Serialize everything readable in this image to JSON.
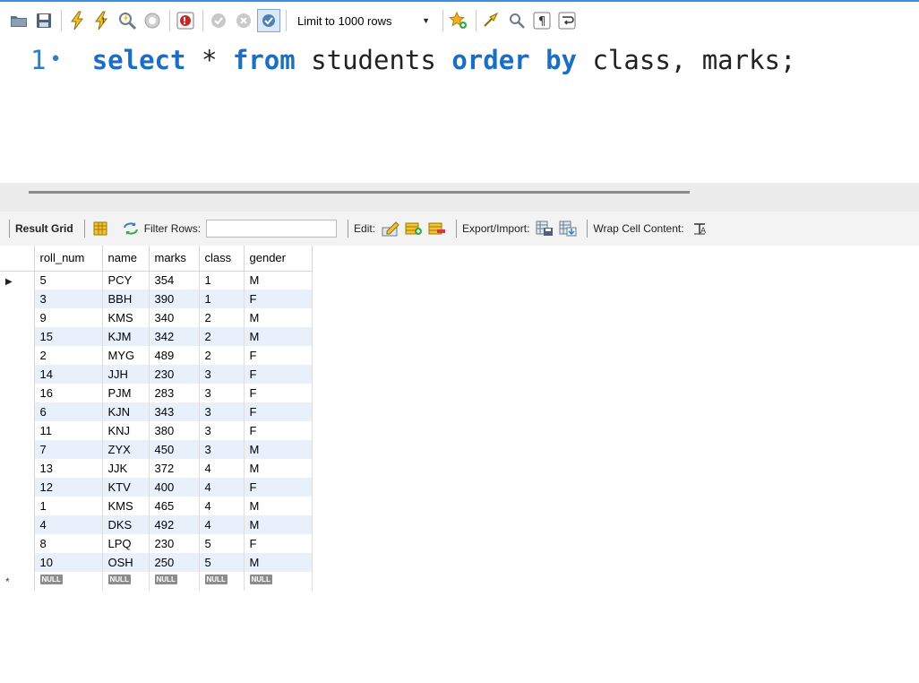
{
  "toolbar": {
    "limit_label": "Limit to 1000 rows",
    "icons": [
      "folder-icon",
      "save-icon",
      "lightning-icon",
      "lightning-cursor-icon",
      "magnifier-explain-icon",
      "stop-icon",
      "toggle-continue-icon",
      "commit-icon",
      "rollback-icon",
      "autocommit-icon",
      "bookmark-star-icon",
      "beautify-broom-icon",
      "find-icon",
      "invisible-chars-icon",
      "wrap-icon"
    ]
  },
  "editor": {
    "line_number": "1",
    "tokens": {
      "select": "select",
      "star": " * ",
      "from": "from",
      "table": " students ",
      "order_by": "order by",
      "columns": " class, marks;"
    }
  },
  "result_toolbar": {
    "result_grid": "Result Grid",
    "filter_rows": "Filter Rows:",
    "filter_value": "",
    "edit": "Edit:",
    "export_import": "Export/Import:",
    "wrap_cell": "Wrap Cell Content:"
  },
  "grid": {
    "columns": [
      "roll_num",
      "name",
      "marks",
      "class",
      "gender"
    ],
    "rows": [
      [
        "5",
        "PCY",
        "354",
        "1",
        "M"
      ],
      [
        "3",
        "BBH",
        "390",
        "1",
        "F"
      ],
      [
        "9",
        "KMS",
        "340",
        "2",
        "M"
      ],
      [
        "15",
        "KJM",
        "342",
        "2",
        "M"
      ],
      [
        "2",
        "MYG",
        "489",
        "2",
        "F"
      ],
      [
        "14",
        "JJH",
        "230",
        "3",
        "F"
      ],
      [
        "16",
        "PJM",
        "283",
        "3",
        "F"
      ],
      [
        "6",
        "KJN",
        "343",
        "3",
        "F"
      ],
      [
        "11",
        "KNJ",
        "380",
        "3",
        "F"
      ],
      [
        "7",
        "ZYX",
        "450",
        "3",
        "M"
      ],
      [
        "13",
        "JJK",
        "372",
        "4",
        "M"
      ],
      [
        "12",
        "KTV",
        "400",
        "4",
        "F"
      ],
      [
        "1",
        "KMS",
        "465",
        "4",
        "M"
      ],
      [
        "4",
        "DKS",
        "492",
        "4",
        "M"
      ],
      [
        "8",
        "LPQ",
        "230",
        "5",
        "F"
      ],
      [
        "10",
        "OSH",
        "250",
        "5",
        "M"
      ]
    ],
    "null_label": "NULL",
    "selected_row_marker": "▶",
    "new_row_marker": "*"
  },
  "colors": {
    "keyword": "#1a6fc4",
    "line_number": "#2f7cc4",
    "row_stripe": "#e8f0fb",
    "accent_top": "#3c8fd8"
  }
}
